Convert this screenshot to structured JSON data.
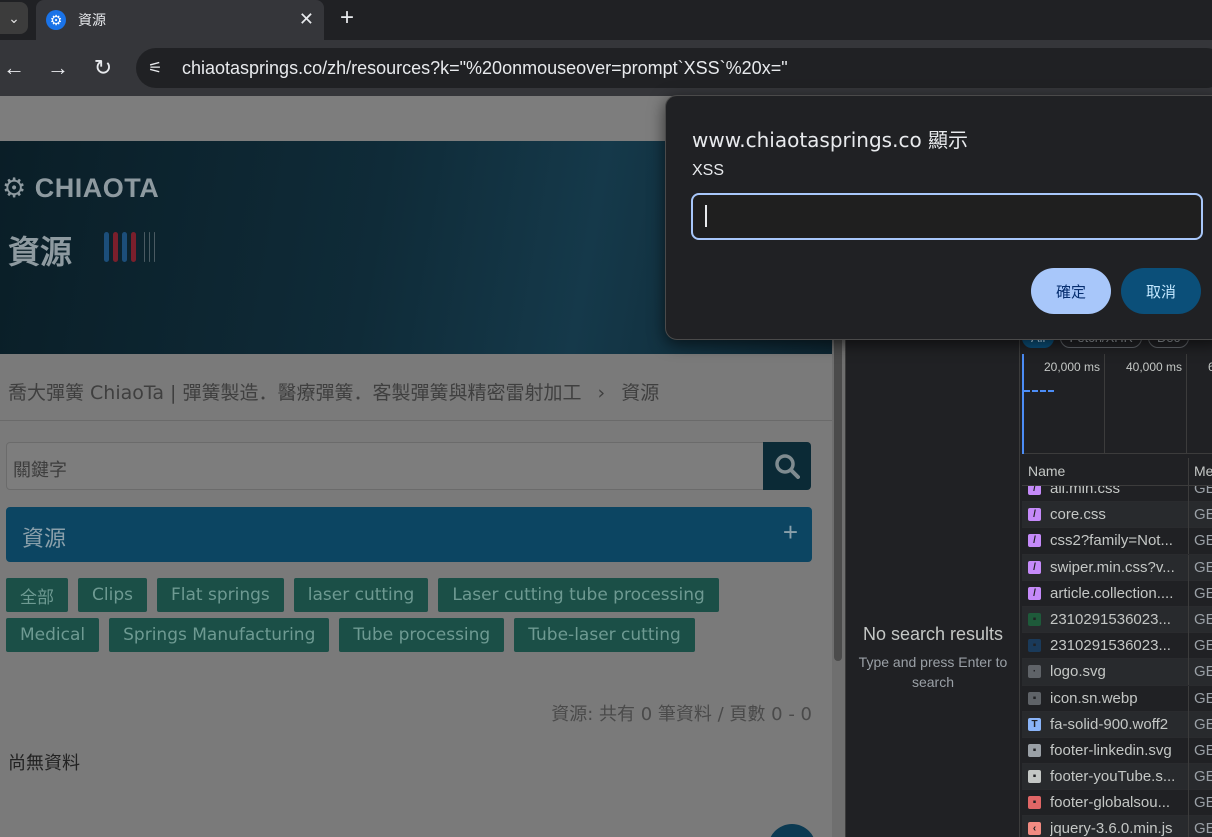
{
  "browser": {
    "tab_title": "資源",
    "address": "chiaotasprings.co/zh/resources?k=\"%20onmouseover=prompt`XSS`%20x=\""
  },
  "page": {
    "logo_text": "CHIAOTA",
    "hero_title": "資源",
    "breadcrumb": "喬大彈簧 ChiaoTa | 彈簧製造．醫療彈簧．客製彈簧與精密雷射加工",
    "breadcrumb_sep": "›",
    "breadcrumb_current": "資源",
    "search_placeholder": "關鍵字",
    "accordion_label": "資源",
    "accordion_toggle": "+",
    "tags": [
      "全部",
      "Clips",
      "Flat springs",
      "laser cutting",
      "Laser cutting tube processing",
      "Medical",
      "Springs Manufacturing",
      "Tube processing",
      "Tube-laser cutting"
    ],
    "count_text": "資源: 共有 0 筆資料 / 頁數 0 - 0",
    "no_data": "尚無資料"
  },
  "devtools": {
    "no_results": "No search results",
    "no_results_hint": "Type and press Enter to search",
    "filters": [
      "All",
      "Fetch/XHR",
      "Doc"
    ],
    "timeline_ticks": [
      "20,000 ms",
      "40,000 ms",
      "6"
    ],
    "columns": {
      "name": "Name",
      "method": "Me"
    },
    "rows": [
      {
        "name": "all.min.css",
        "method": "GE",
        "icon": "css",
        "color": "#c58af9"
      },
      {
        "name": "core.css",
        "method": "GE",
        "icon": "css",
        "color": "#c58af9"
      },
      {
        "name": "css2?family=Not...",
        "method": "GE",
        "icon": "css",
        "color": "#c58af9"
      },
      {
        "name": "swiper.min.css?v...",
        "method": "GE",
        "icon": "css",
        "color": "#c58af9"
      },
      {
        "name": "article.collection....",
        "method": "GE",
        "icon": "css",
        "color": "#c58af9"
      },
      {
        "name": "2310291536023...",
        "method": "GE",
        "icon": "img",
        "color": "#1e5a3a"
      },
      {
        "name": "2310291536023...",
        "method": "GE",
        "icon": "img",
        "color": "#1a3a5a"
      },
      {
        "name": "logo.svg",
        "method": "GE",
        "icon": "svg",
        "color": "#5f6368"
      },
      {
        "name": "icon.sn.webp",
        "method": "GE",
        "icon": "img",
        "color": "#5f6368"
      },
      {
        "name": "fa-solid-900.woff2",
        "method": "GE",
        "icon": "font",
        "color": "#8ab4f8"
      },
      {
        "name": "footer-linkedin.svg",
        "method": "GE",
        "icon": "img",
        "color": "#9aa0a6"
      },
      {
        "name": "footer-youTube.s...",
        "method": "GE",
        "icon": "img",
        "color": "#c4c7c5"
      },
      {
        "name": "footer-globalsou...",
        "method": "GE",
        "icon": "img",
        "color": "#e06666"
      },
      {
        "name": "jquery-3.6.0.min.js",
        "method": "GE",
        "icon": "js",
        "color": "#f28b82"
      }
    ]
  },
  "dialog": {
    "origin": "www.chiaotasprings.co 顯示",
    "message": "XSS",
    "input_value": "",
    "ok_label": "確定",
    "cancel_label": "取消"
  }
}
